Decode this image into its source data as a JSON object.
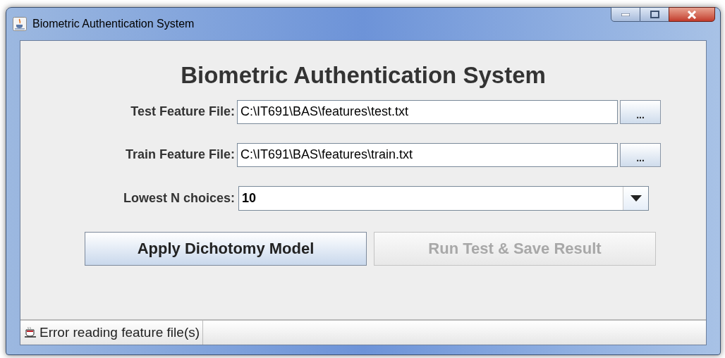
{
  "window": {
    "title": "Biometric Authentication System"
  },
  "heading": "Biometric Authentication System",
  "fields": [
    {
      "kind": "file",
      "label": "Test Feature File:",
      "value": "C:\\IT691\\BAS\\features\\test.txt",
      "browse": "..."
    },
    {
      "kind": "file",
      "label": "Train Feature File:",
      "value": "C:\\IT691\\BAS\\features\\train.txt",
      "browse": "..."
    },
    {
      "kind": "combo",
      "label": "Lowest N choices:",
      "value": "10"
    }
  ],
  "buttons": [
    {
      "label": "Apply Dichotomy Model",
      "disabled": false
    },
    {
      "label": "Run Test & Save Result",
      "disabled": true
    }
  ],
  "status_bar": {
    "text": "Error reading feature file(s)"
  }
}
